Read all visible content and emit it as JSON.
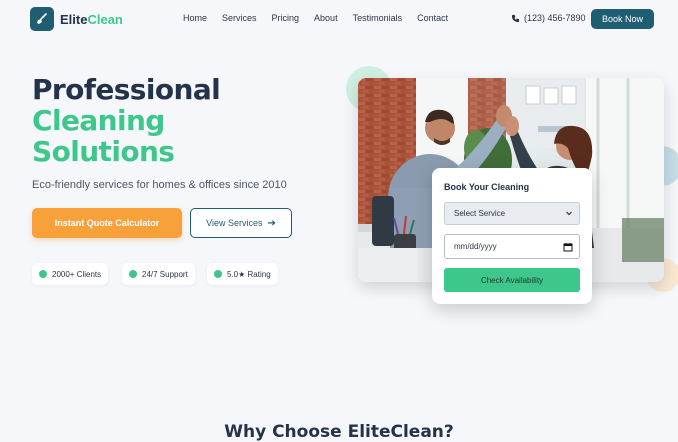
{
  "nav": {
    "brand_part1": "Elite",
    "brand_part2": "Clean",
    "links": [
      "Home",
      "Services",
      "Pricing",
      "About",
      "Testimonials",
      "Contact"
    ],
    "phone": "(123) 456-7890",
    "book_label": "Book Now"
  },
  "hero": {
    "title_line1": "Professional",
    "title_line2": "Cleaning",
    "title_line3": "Solutions",
    "subtitle": "Eco-friendly services for homes & offices since 2010",
    "quote_button": "Instant Quote Calculator",
    "services_button": "View Services",
    "badges": [
      "2000+ Clients",
      "24/7 Support",
      "5.0★ Rating"
    ]
  },
  "booking": {
    "title": "Book Your Cleaning",
    "service_selected": "Select Service",
    "date_value": "mm/dd/yyyy",
    "submit_label": "Check Availability"
  },
  "section": {
    "why_title": "Why Choose EliteClean?"
  },
  "colors": {
    "primary": "#1f5d73",
    "accent_green": "#3ec78b",
    "accent_orange": "#f8a03a"
  }
}
